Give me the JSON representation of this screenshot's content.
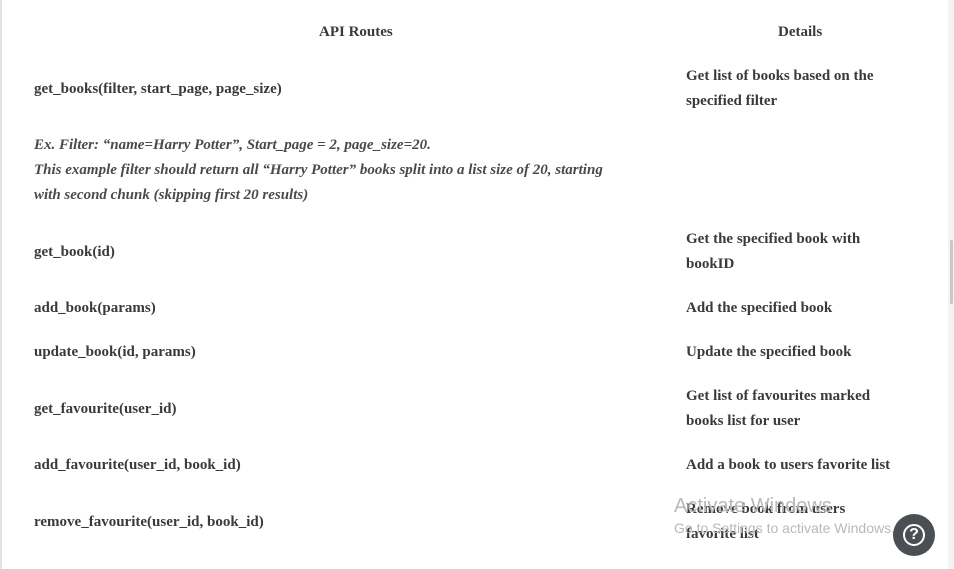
{
  "table": {
    "headers": {
      "routes": "API Routes",
      "details": "Details"
    },
    "rows": [
      {
        "route": "get_books(filter, start_page, page_size)",
        "detail_lines": [
          "Get list of books based on the",
          "specified filter"
        ]
      },
      {
        "route": "get_book(id)",
        "detail_lines": [
          "Get the specified book with",
          "bookID"
        ]
      },
      {
        "route": "add_book(params)",
        "detail_lines": [
          "Add the specified book"
        ]
      },
      {
        "route": "update_book(id, params)",
        "detail_lines": [
          "Update the specified book"
        ]
      },
      {
        "route": "get_favourite(user_id)",
        "detail_lines": [
          "Get list of favourites marked",
          "books list for user"
        ]
      },
      {
        "route": "add_favourite(user_id, book_id)",
        "detail_lines": [
          "Add a book to users favorite list"
        ]
      },
      {
        "route": "remove_favourite(user_id, book_id)",
        "detail_lines": [
          "Remove book from users",
          "favorite list"
        ]
      }
    ],
    "example_lines": [
      "Ex.   Filter: “name=Harry Potter”,    Start_page = 2, page_size=20.",
      "This example filter should return all “Harry Potter” books split into a list size of 20, starting",
      "with second chunk (skipping first 20 results)"
    ]
  },
  "watermark": {
    "title": "Activate Windows",
    "subtitle": "Go to Settings to activate Windows."
  },
  "help_button": {
    "label": "?",
    "icon": "question-mark-icon"
  }
}
